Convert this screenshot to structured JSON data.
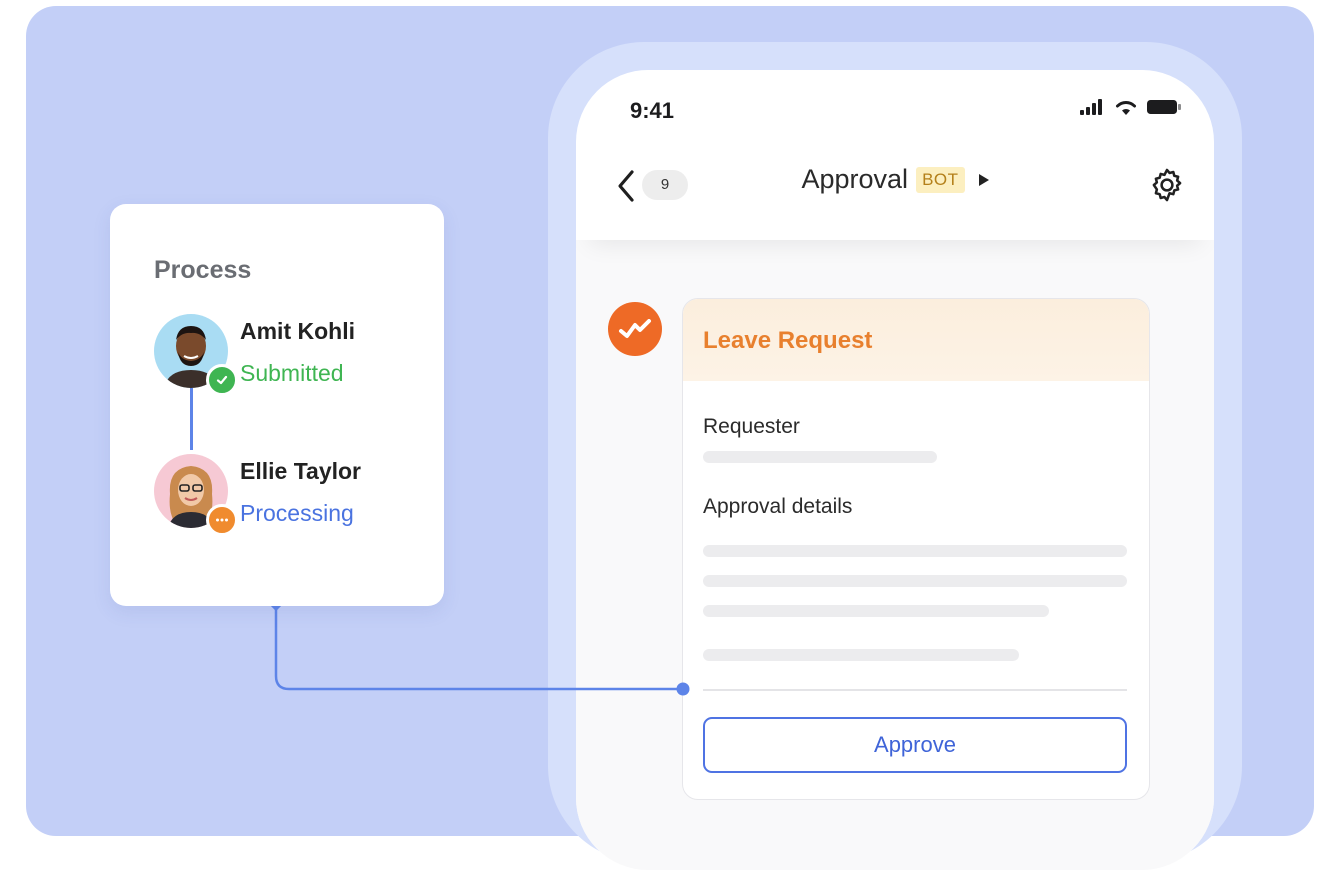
{
  "colors": {
    "background": "#c3cff7",
    "accent_blue": "#4f73e3",
    "bot_orange": "#ee6a26",
    "submitted_green": "#3fb552",
    "processing_blue": "#4a73e0",
    "leave_title": "#e8802e"
  },
  "phone": {
    "status_bar": {
      "time": "9:41",
      "icons": [
        "signal-icon",
        "wifi-icon",
        "battery-icon"
      ]
    },
    "nav": {
      "back_icon": "chevron-left-icon",
      "unread_count": "9",
      "title": "Approval",
      "bot_badge": "BOT",
      "expand_icon": "play-triangle-icon",
      "settings_icon": "gear-icon"
    },
    "message": {
      "avatar_icon": "bot-logo-icon",
      "card": {
        "title": "Leave Request",
        "requester_label": "Requester",
        "details_label": "Approval details",
        "approve_label": "Approve"
      }
    }
  },
  "process": {
    "title": "Process",
    "steps": [
      {
        "name": "Amit Kohli",
        "status": "Submitted",
        "status_icon": "check-icon"
      },
      {
        "name": "Ellie Taylor",
        "status": "Processing",
        "status_icon": "more-dots-icon"
      }
    ]
  }
}
